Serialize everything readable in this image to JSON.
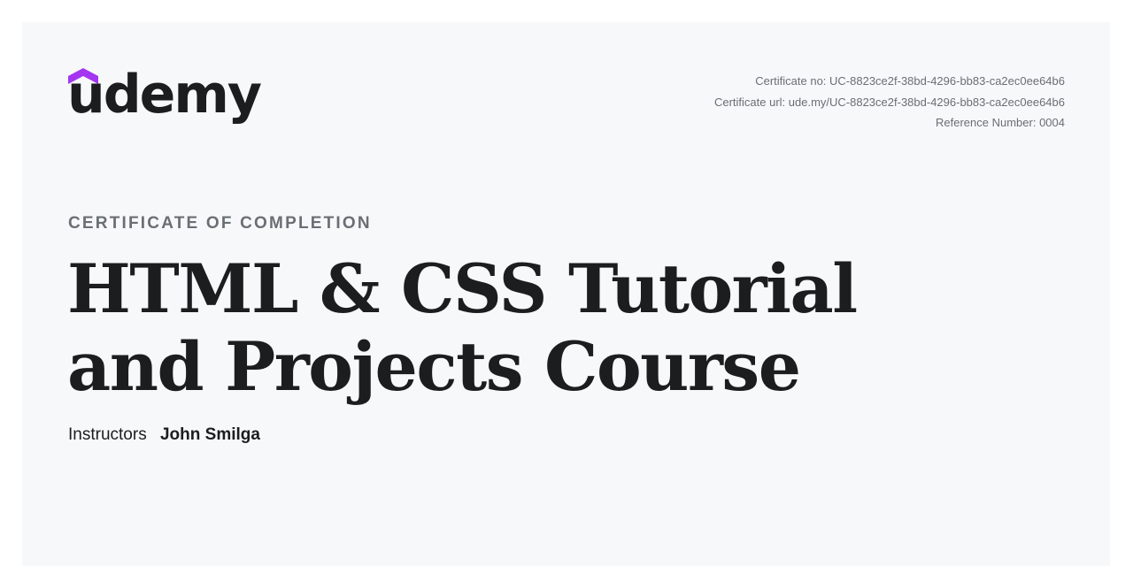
{
  "brand": {
    "logo_text": "udemy",
    "accent_color": "#a435f0",
    "text_color": "#1c1d1f",
    "logo_icon": "graduation-cap-roof-icon"
  },
  "certificate": {
    "number_line": "Certificate no: UC-8823ce2f-38bd-4296-bb83-ca2ec0ee64b6",
    "url_line": "Certificate url: ude.my/UC-8823ce2f-38bd-4296-bb83-ca2ec0ee64b6",
    "reference_line": "Reference Number: 0004",
    "kicker": "CERTIFICATE OF COMPLETION",
    "course_title": "HTML & CSS Tutorial and Projects Course",
    "instructors_label": "Instructors",
    "instructor_name": "John Smilga"
  }
}
